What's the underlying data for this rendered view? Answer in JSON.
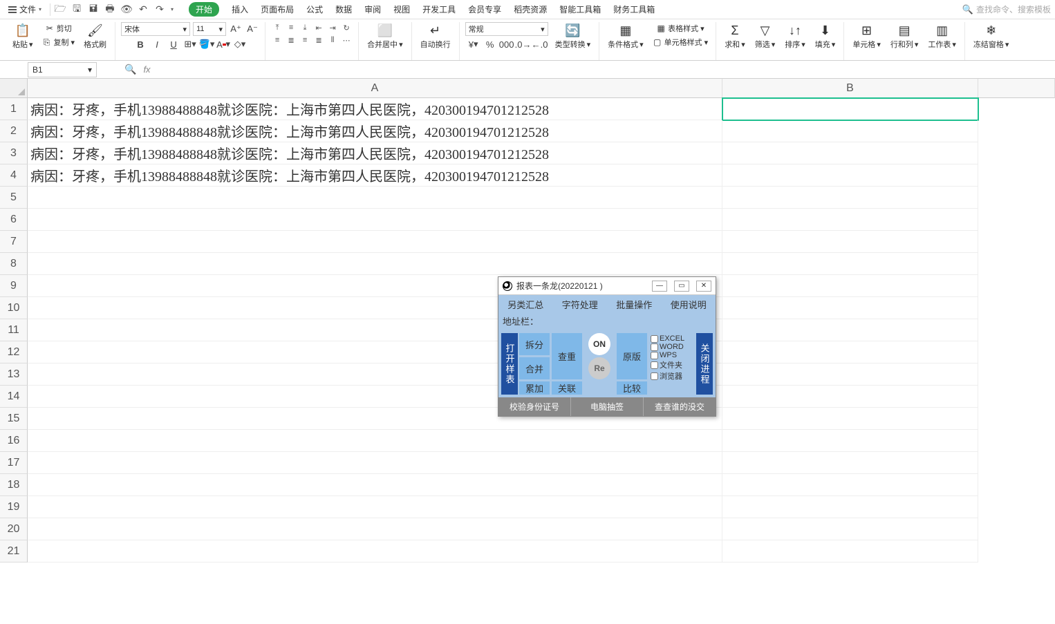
{
  "menubar": {
    "file": "文件",
    "tabs": [
      "开始",
      "插入",
      "页面布局",
      "公式",
      "数据",
      "审阅",
      "视图",
      "开发工具",
      "会员专享",
      "稻壳资源",
      "智能工具箱",
      "财务工具箱"
    ],
    "active_tab": 0,
    "search_placeholder": "查找命令、搜索模板"
  },
  "ribbon": {
    "paste": "粘贴",
    "cut": "剪切",
    "copy": "复制",
    "fmt_painter": "格式刷",
    "font_name": "宋体",
    "font_size": "11",
    "merge": "合并居中",
    "wrap": "自动换行",
    "num_format": "常规",
    "type_convert": "类型转换",
    "cond_fmt": "条件格式",
    "table_style": "表格样式",
    "cell_style": "单元格样式",
    "sum": "求和",
    "filter": "筛选",
    "sort": "排序",
    "fill": "填充",
    "cell": "单元格",
    "rowcol": "行和列",
    "sheet": "工作表",
    "freeze": "冻结窗格"
  },
  "formula_bar": {
    "name_box": "B1",
    "formula": ""
  },
  "grid": {
    "columns": [
      "A",
      "B"
    ],
    "rows": [
      {
        "n": 1,
        "A": "病因：牙疼，手机13988488848就诊医院：上海市第四人民医院，420300194701212528"
      },
      {
        "n": 2,
        "A": "病因：牙疼，手机13988488848就诊医院：上海市第四人民医院，420300194701212528"
      },
      {
        "n": 3,
        "A": "病因：牙疼，手机13988488848就诊医院：上海市第四人民医院，420300194701212528"
      },
      {
        "n": 4,
        "A": "病因：牙疼，手机13988488848就诊医院：上海市第四人民医院，420300194701212528"
      },
      {
        "n": 5
      },
      {
        "n": 6
      },
      {
        "n": 7
      },
      {
        "n": 8
      },
      {
        "n": 9
      },
      {
        "n": 10
      },
      {
        "n": 11
      },
      {
        "n": 12
      },
      {
        "n": 13
      },
      {
        "n": 14
      },
      {
        "n": 15
      },
      {
        "n": 16
      },
      {
        "n": 17
      },
      {
        "n": 18
      },
      {
        "n": 19
      },
      {
        "n": 20
      },
      {
        "n": 21
      }
    ],
    "selected": "B1"
  },
  "dialog": {
    "title": "报表一条龙(20220121 )",
    "menu": [
      "另类汇总",
      "字符处理",
      "批量操作",
      "使用说明"
    ],
    "addr_label": "地址栏：",
    "left_btn": "打开样表",
    "right_btn": "关闭进程",
    "btns": {
      "split": "拆分",
      "merge": "合并",
      "dedup": "查重",
      "on": "ON",
      "orig": "原版",
      "accum": "累加",
      "link": "关联",
      "re": "Re",
      "compare": "比较"
    },
    "checks": [
      "EXCEL",
      "WORD",
      "WPS",
      "文件夹",
      "浏览器"
    ],
    "footer": [
      "校验身份证号",
      "电脑抽签",
      "查查谁的没交"
    ]
  }
}
